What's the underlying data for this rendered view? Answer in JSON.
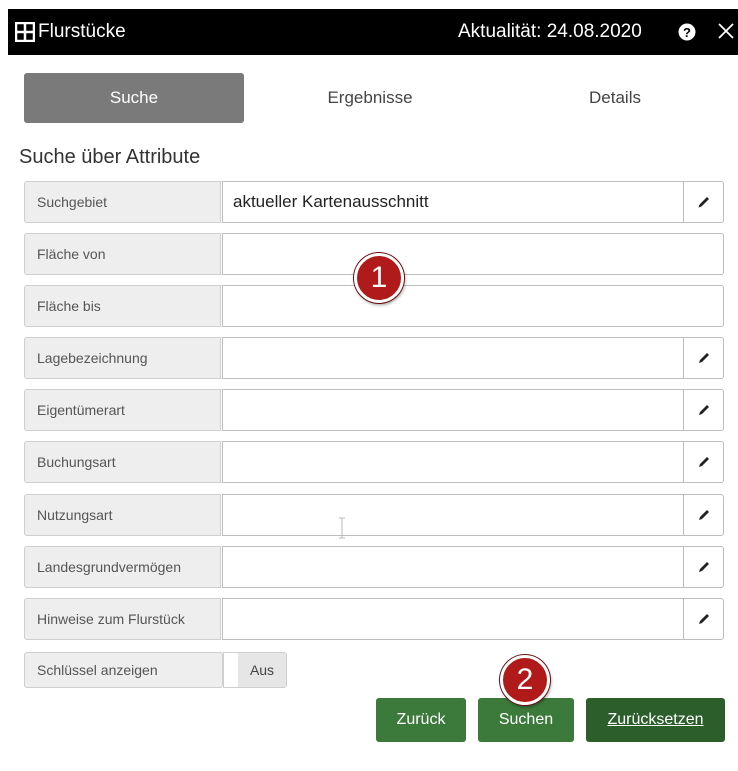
{
  "window": {
    "title": "Flurstücke",
    "aktualitaet": "Aktualität: 24.08.2020",
    "icons": {
      "title": "grid-icon",
      "help": "help-icon",
      "close": "close-icon"
    }
  },
  "tabs": [
    {
      "label": "Suche",
      "active": true
    },
    {
      "label": "Ergebnisse",
      "active": false
    },
    {
      "label": "Details",
      "active": false
    }
  ],
  "section_title": "Suche über Attribute",
  "fields": [
    {
      "label": "Suchgebiet",
      "value": "aktueller Kartenausschnitt",
      "editable": true
    },
    {
      "label": "Fläche von",
      "value": "",
      "editable": false
    },
    {
      "label": "Fläche bis",
      "value": "",
      "editable": false
    },
    {
      "label": "Lagebezeichnung",
      "value": "",
      "editable": true
    },
    {
      "label": "Eigentümerart",
      "value": "",
      "editable": true
    },
    {
      "label": "Buchungsart",
      "value": "",
      "editable": true
    },
    {
      "label": "Nutzungsart",
      "value": "",
      "editable": true
    },
    {
      "label": "Landesgrundvermögen",
      "value": "",
      "editable": true
    },
    {
      "label": "Hinweise zum Flurstück",
      "value": "",
      "editable": true
    }
  ],
  "toggle": {
    "label": "Schlüssel anzeigen",
    "state": "Aus"
  },
  "buttons": {
    "back": "Zurück",
    "search": "Suchen",
    "reset": "Zurücksetzen"
  },
  "badges": {
    "one": "1",
    "two": "2"
  },
  "colors": {
    "titlebar": "#000000",
    "active_tab": "#7a7a7a",
    "button_green": "#3b7a3b",
    "badge_red": "#b01a1a"
  }
}
